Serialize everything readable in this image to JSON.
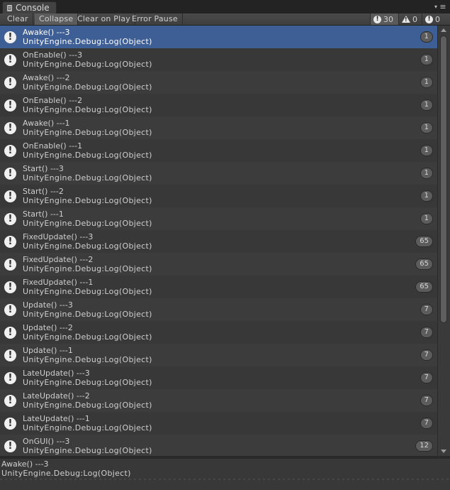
{
  "window": {
    "tab_title": "Console"
  },
  "toolbar": {
    "clear": "Clear",
    "collapse": "Collapse",
    "clear_on_play": "Clear on Play",
    "error_pause": "Error Pause",
    "log_count": "30",
    "warning_count": "0",
    "error_count": "0"
  },
  "entries": [
    {
      "line1": "Awake() ---3",
      "line2": "UnityEngine.Debug:Log(Object)",
      "count": "1",
      "selected": true
    },
    {
      "line1": "OnEnable() ---3",
      "line2": "UnityEngine.Debug:Log(Object)",
      "count": "1"
    },
    {
      "line1": "Awake() ---2",
      "line2": "UnityEngine.Debug:Log(Object)",
      "count": "1"
    },
    {
      "line1": "OnEnable() ---2",
      "line2": "UnityEngine.Debug:Log(Object)",
      "count": "1"
    },
    {
      "line1": "Awake() ---1",
      "line2": "UnityEngine.Debug:Log(Object)",
      "count": "1"
    },
    {
      "line1": "OnEnable() ---1",
      "line2": "UnityEngine.Debug:Log(Object)",
      "count": "1"
    },
    {
      "line1": "Start() ---3",
      "line2": "UnityEngine.Debug:Log(Object)",
      "count": "1"
    },
    {
      "line1": "Start() ---2",
      "line2": "UnityEngine.Debug:Log(Object)",
      "count": "1"
    },
    {
      "line1": "Start() ---1",
      "line2": "UnityEngine.Debug:Log(Object)",
      "count": "1"
    },
    {
      "line1": "FixedUpdate() ---3",
      "line2": "UnityEngine.Debug:Log(Object)",
      "count": "65"
    },
    {
      "line1": "FixedUpdate() ---2",
      "line2": "UnityEngine.Debug:Log(Object)",
      "count": "65"
    },
    {
      "line1": "FixedUpdate() ---1",
      "line2": "UnityEngine.Debug:Log(Object)",
      "count": "65"
    },
    {
      "line1": "Update() ---3",
      "line2": "UnityEngine.Debug:Log(Object)",
      "count": "7"
    },
    {
      "line1": "Update() ---2",
      "line2": "UnityEngine.Debug:Log(Object)",
      "count": "7"
    },
    {
      "line1": "Update() ---1",
      "line2": "UnityEngine.Debug:Log(Object)",
      "count": "7"
    },
    {
      "line1": "LateUpdate() ---3",
      "line2": "UnityEngine.Debug:Log(Object)",
      "count": "7"
    },
    {
      "line1": "LateUpdate() ---2",
      "line2": "UnityEngine.Debug:Log(Object)",
      "count": "7"
    },
    {
      "line1": "LateUpdate() ---1",
      "line2": "UnityEngine.Debug:Log(Object)",
      "count": "7"
    },
    {
      "line1": "OnGUI() ---3",
      "line2": "UnityEngine.Debug:Log(Object)",
      "count": "12"
    }
  ],
  "detail": {
    "line1": "Awake() ---3",
    "line2": "UnityEngine.Debug:Log(Object)"
  },
  "colors": {
    "selected_row": "#3e5f96",
    "panel_bg": "#3a3a3a"
  }
}
